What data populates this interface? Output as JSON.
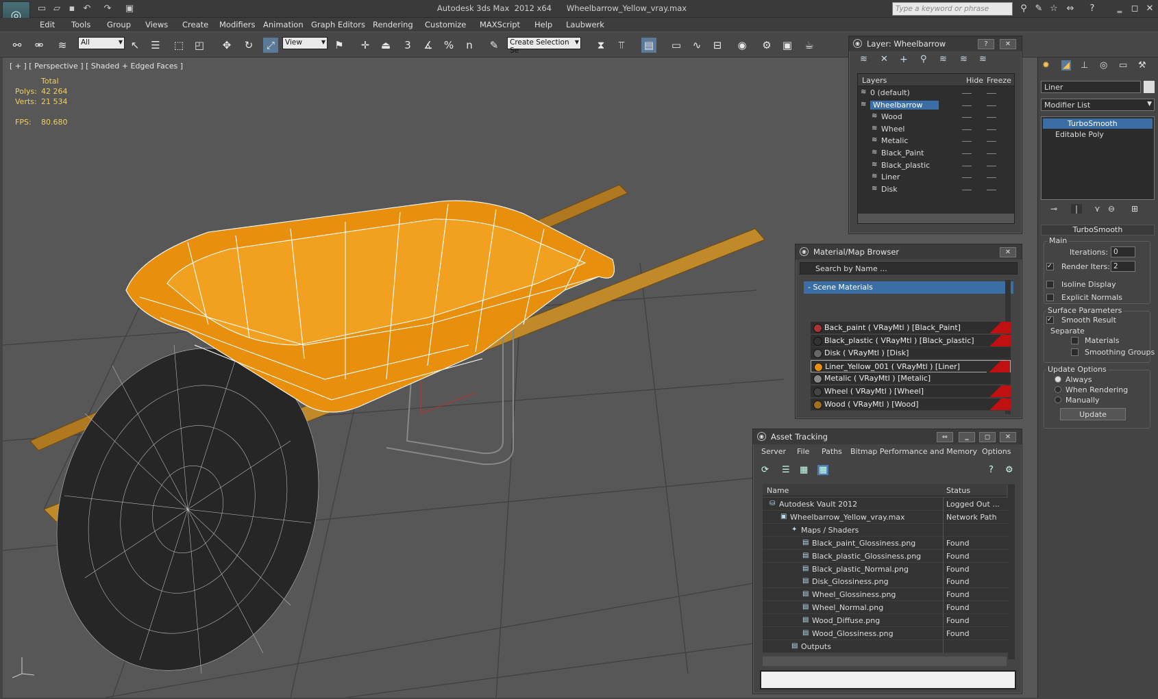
{
  "app": {
    "title": "Autodesk 3ds Max  2012 x64      Wheelbarrow_Yellow_vray.max",
    "search_placeholder": "Type a keyword or phrase"
  },
  "menu": [
    "Edit",
    "Tools",
    "Group",
    "Views",
    "Create",
    "Modifiers",
    "Animation",
    "Graph Editors",
    "Rendering",
    "Customize",
    "MAXScript",
    "Help",
    "Laubwerk"
  ],
  "toolbar": {
    "filter": "All",
    "ref_coord": "View",
    "selection_set": "Create Selection Se",
    "snap_3": "3",
    "snap_pct": "%",
    "snap_n": "n"
  },
  "viewport": {
    "label": "[ + ] [ Perspective ] [ Shaded + Edged Faces ]",
    "stats": {
      "total": "Total",
      "polys_label": "Polys:",
      "polys": "42 264",
      "verts_label": "Verts:",
      "verts": "21 534",
      "fps_label": "FPS:",
      "fps": "80.680"
    },
    "colors": {
      "bucket": "#e8900e",
      "handle": "#b07820",
      "wire": "#ffffff",
      "tire": "#2a2a2a",
      "grid": "#3e3e3e"
    }
  },
  "layers": {
    "title": "Layer: Wheelbarrow",
    "col_layers": "Layers",
    "col_hide": "Hide",
    "col_freeze": "Freeze",
    "items": [
      "0 (default)",
      "Wheelbarrow",
      "Wood",
      "Wheel",
      "Metalic",
      "Black_Paint",
      "Black_plastic",
      "Liner",
      "Disk"
    ],
    "active": "Wheelbarrow"
  },
  "materials": {
    "title": "Material/Map Browser",
    "search": "Search by Name ...",
    "group": "- Scene Materials",
    "items": [
      "Back_paint  ( VRayMtl ) [Black_Paint]",
      "Black_plastic  ( VRayMtl ) [Black_plastic]",
      "Disk  ( VRayMtl ) [Disk]",
      "Liner_Yellow_001  ( VRayMtl ) [Liner]",
      "Metalic  ( VRayMtl ) [Metalic]",
      "Wheel  ( VRayMtl ) [Wheel]",
      "Wood  ( VRayMtl ) [Wood]"
    ]
  },
  "assets": {
    "title": "Asset Tracking",
    "menu": [
      "Server",
      "File",
      "Paths",
      "Bitmap Performance and Memory",
      "Options"
    ],
    "col_name": "Name",
    "col_status": "Status",
    "rows": [
      {
        "name": "Autodesk Vault 2012",
        "status": "Logged Out ..."
      },
      {
        "name": "Wheelbarrow_Yellow_vray.max",
        "status": "Network Path"
      },
      {
        "name": "Maps / Shaders",
        "status": ""
      },
      {
        "name": "Black_paint_Glossiness.png",
        "status": "Found"
      },
      {
        "name": "Black_plastic_Glossiness.png",
        "status": "Found"
      },
      {
        "name": "Black_plastic_Normal.png",
        "status": "Found"
      },
      {
        "name": "Disk_Glossiness.png",
        "status": "Found"
      },
      {
        "name": "Wheel_Glossiness.png",
        "status": "Found"
      },
      {
        "name": "Wheel_Normal.png",
        "status": "Found"
      },
      {
        "name": "Wood_Diffuse.png",
        "status": "Found"
      },
      {
        "name": "Wood_Glossiness.png",
        "status": "Found"
      },
      {
        "name": "Outputs",
        "status": ""
      }
    ]
  },
  "command": {
    "object_name": "Liner",
    "modifier_list": "Modifier List",
    "stack": [
      "TurboSmooth",
      "Editable Poly"
    ],
    "rollout": "TurboSmooth",
    "main": "Main",
    "iterations_label": "Iterations:",
    "iterations": "0",
    "render_iters_label": "Render Iters:",
    "render_iters": "2",
    "isoline": "Isoline Display",
    "explicit": "Explicit Normals",
    "surface": "Surface Parameters",
    "smooth_result": "Smooth Result",
    "separate": "Separate",
    "materials": "Materials",
    "smoothing": "Smoothing Groups",
    "update_options": "Update Options",
    "always": "Always",
    "when_rendering": "When Rendering",
    "manually": "Manually",
    "update_btn": "Update"
  }
}
